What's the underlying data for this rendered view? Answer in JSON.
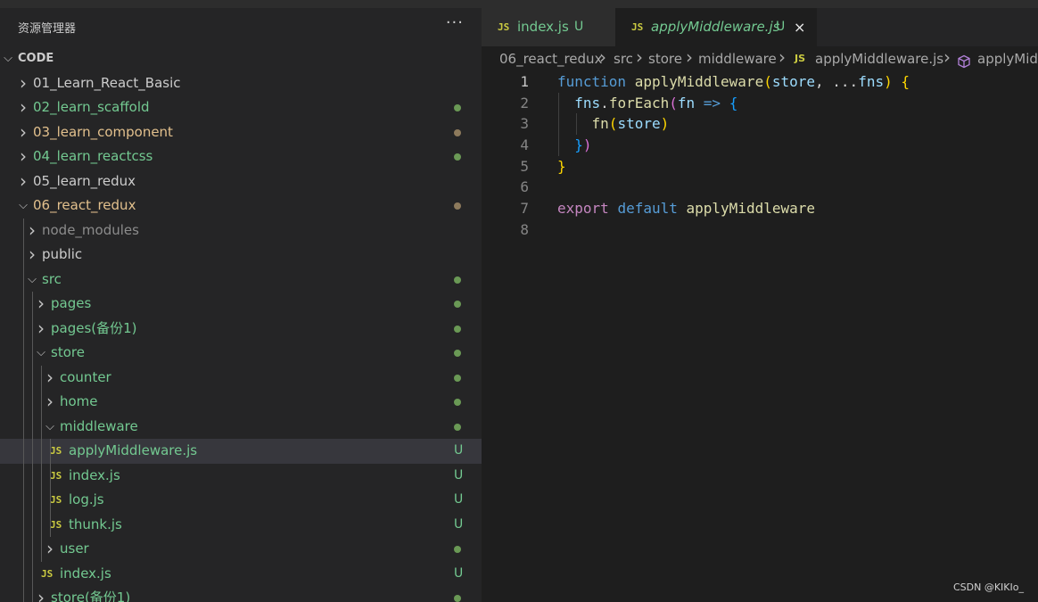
{
  "explorer": {
    "title": "资源管理器",
    "more_icon": "ellipsis-icon",
    "root_label": "CODE",
    "tree": [
      {
        "label": "01_Learn_React_Basic",
        "type": "folder",
        "expanded": false,
        "depth": 0,
        "color": "#cccccc",
        "status": "none"
      },
      {
        "label": "02_learn_scaffold",
        "type": "folder",
        "expanded": false,
        "depth": 0,
        "color": "#73c991",
        "status": "dot",
        "status_color": "#6a9955"
      },
      {
        "label": "03_learn_component",
        "type": "folder",
        "expanded": false,
        "depth": 0,
        "color": "#e2c08d",
        "status": "dot",
        "status_color": "#8d7a5c"
      },
      {
        "label": "04_learn_reactcss",
        "type": "folder",
        "expanded": false,
        "depth": 0,
        "color": "#73c991",
        "status": "dot",
        "status_color": "#6a9955"
      },
      {
        "label": "05_learn_redux",
        "type": "folder",
        "expanded": false,
        "depth": 0,
        "color": "#cccccc",
        "status": "none"
      },
      {
        "label": "06_react_redux",
        "type": "folder",
        "expanded": true,
        "depth": 0,
        "color": "#e2c08d",
        "status": "dot",
        "status_color": "#8d7a5c"
      },
      {
        "label": "node_modules",
        "type": "folder",
        "expanded": false,
        "depth": 1,
        "color": "#8c8c8c",
        "status": "none"
      },
      {
        "label": "public",
        "type": "folder",
        "expanded": false,
        "depth": 1,
        "color": "#cccccc",
        "status": "none"
      },
      {
        "label": "src",
        "type": "folder",
        "expanded": true,
        "depth": 1,
        "color": "#73c991",
        "status": "dot",
        "status_color": "#6a9955"
      },
      {
        "label": "pages",
        "type": "folder",
        "expanded": false,
        "depth": 2,
        "color": "#73c991",
        "status": "dot",
        "status_color": "#6a9955"
      },
      {
        "label": "pages(备份1)",
        "type": "folder",
        "expanded": false,
        "depth": 2,
        "color": "#73c991",
        "status": "dot",
        "status_color": "#6a9955"
      },
      {
        "label": "store",
        "type": "folder",
        "expanded": true,
        "depth": 2,
        "color": "#73c991",
        "status": "dot",
        "status_color": "#6a9955"
      },
      {
        "label": "counter",
        "type": "folder",
        "expanded": false,
        "depth": 3,
        "color": "#73c991",
        "status": "dot",
        "status_color": "#6a9955"
      },
      {
        "label": "home",
        "type": "folder",
        "expanded": false,
        "depth": 3,
        "color": "#73c991",
        "status": "dot",
        "status_color": "#6a9955"
      },
      {
        "label": "middleware",
        "type": "folder",
        "expanded": true,
        "depth": 3,
        "color": "#73c991",
        "status": "dot",
        "status_color": "#6a9955"
      },
      {
        "label": "applyMiddleware.js",
        "type": "file",
        "depth": 4,
        "color": "#73c991",
        "status": "U",
        "selected": true
      },
      {
        "label": "index.js",
        "type": "file",
        "depth": 4,
        "color": "#73c991",
        "status": "U"
      },
      {
        "label": "log.js",
        "type": "file",
        "depth": 4,
        "color": "#73c991",
        "status": "U"
      },
      {
        "label": "thunk.js",
        "type": "file",
        "depth": 4,
        "color": "#73c991",
        "status": "U"
      },
      {
        "label": "user",
        "type": "folder",
        "expanded": false,
        "depth": 3,
        "color": "#73c991",
        "status": "dot",
        "status_color": "#6a9955"
      },
      {
        "label": "index.js",
        "type": "file",
        "depth": 3,
        "color": "#73c991",
        "status": "U"
      },
      {
        "label": "store(备份1)",
        "type": "folder",
        "expanded": false,
        "depth": 2,
        "color": "#73c991",
        "status": "dot",
        "status_color": "#6a9955"
      }
    ]
  },
  "tabs": [
    {
      "icon_text": "JS",
      "name": "index.js",
      "badge": "U",
      "active": false
    },
    {
      "icon_text": "JS",
      "name": "applyMiddleware.js",
      "badge": "U",
      "active": true,
      "close_icon": "×"
    }
  ],
  "breadcrumb": {
    "parts": [
      "06_react_redux",
      "src",
      "store",
      "middleware"
    ],
    "file_icon_text": "JS",
    "file": "applyMiddleware.js",
    "symbol_icon": "cube-icon",
    "symbol": "applyMiddleware"
  },
  "code_lines": [
    {
      "n": "1",
      "active": true,
      "tokens": [
        [
          "function",
          "kw"
        ],
        [
          " ",
          "plain"
        ],
        [
          "applyMiddleware",
          "fn"
        ],
        [
          "(",
          "p1"
        ],
        [
          "store",
          "var"
        ],
        [
          ", ",
          "plain"
        ],
        [
          "...",
          "plain"
        ],
        [
          "fns",
          "var"
        ],
        [
          ")",
          "p1"
        ],
        [
          " ",
          "plain"
        ],
        [
          "{",
          "p1"
        ]
      ]
    },
    {
      "n": "2",
      "tokens": [
        [
          "  ",
          "plain"
        ],
        [
          "fns",
          "var"
        ],
        [
          ".",
          "plain"
        ],
        [
          "forEach",
          "fn"
        ],
        [
          "(",
          "p2"
        ],
        [
          "fn",
          "var"
        ],
        [
          " ",
          "plain"
        ],
        [
          "=>",
          "kw"
        ],
        [
          " ",
          "plain"
        ],
        [
          "{",
          "p3"
        ]
      ]
    },
    {
      "n": "3",
      "tokens": [
        [
          "    ",
          "plain"
        ],
        [
          "fn",
          "fn"
        ],
        [
          "(",
          "p1"
        ],
        [
          "store",
          "var"
        ],
        [
          ")",
          "p1"
        ]
      ]
    },
    {
      "n": "4",
      "tokens": [
        [
          "  ",
          "plain"
        ],
        [
          "}",
          "p3"
        ],
        [
          ")",
          "p2"
        ]
      ]
    },
    {
      "n": "5",
      "tokens": [
        [
          "}",
          "p1"
        ]
      ]
    },
    {
      "n": "6",
      "tokens": []
    },
    {
      "n": "7",
      "tokens": [
        [
          "export",
          "ctl"
        ],
        [
          " ",
          "plain"
        ],
        [
          "default",
          "kw"
        ],
        [
          " ",
          "plain"
        ],
        [
          "applyMiddleware",
          "fn"
        ]
      ]
    },
    {
      "n": "8",
      "tokens": []
    }
  ],
  "watermark": "CSDN @KIKIo_"
}
